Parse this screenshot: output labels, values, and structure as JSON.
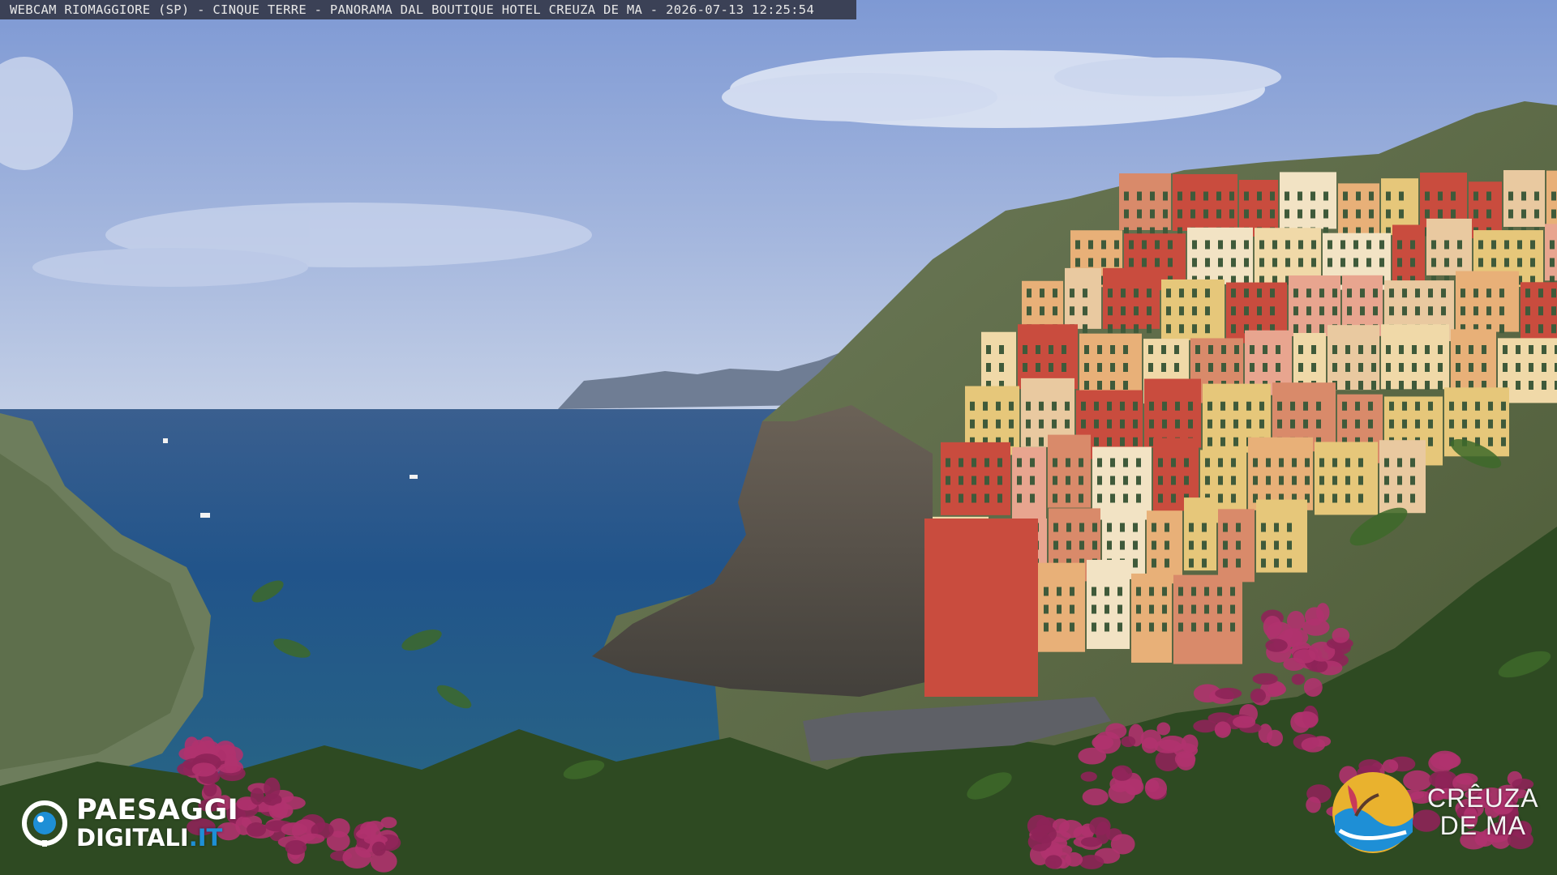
{
  "overlay": {
    "caption": "WEBCAM RIOMAGGIORE (SP) - CINQUE TERRE - PANORAMA DAL BOUTIQUE HOTEL CREUZA DE MA - 2026-07-13 12:25:54"
  },
  "logos": {
    "left": {
      "line1": "PAESAGGI",
      "line2_main": "DIGITALI",
      "line2_suffix": ".IT"
    },
    "right": {
      "line1": "CRÊUZA",
      "line2": "DE MA"
    }
  },
  "scene_colors": {
    "sky_top": "#7f9bd6",
    "sky_horizon": "#b9c8e6",
    "sea_deep": "#1f4f86",
    "sea_near": "#2f6f8c",
    "cliff": "#5a5148",
    "vegetation": "#556b3a",
    "bougainvillea": "#b0326e",
    "facade_red": "#c94c3e",
    "facade_yellow": "#e6c77a",
    "facade_pink": "#e8a58f",
    "brand_blue": "#1e8fd6"
  },
  "icons": [
    "webcam-eye-icon",
    "creuza-de-ma-logo-icon"
  ]
}
